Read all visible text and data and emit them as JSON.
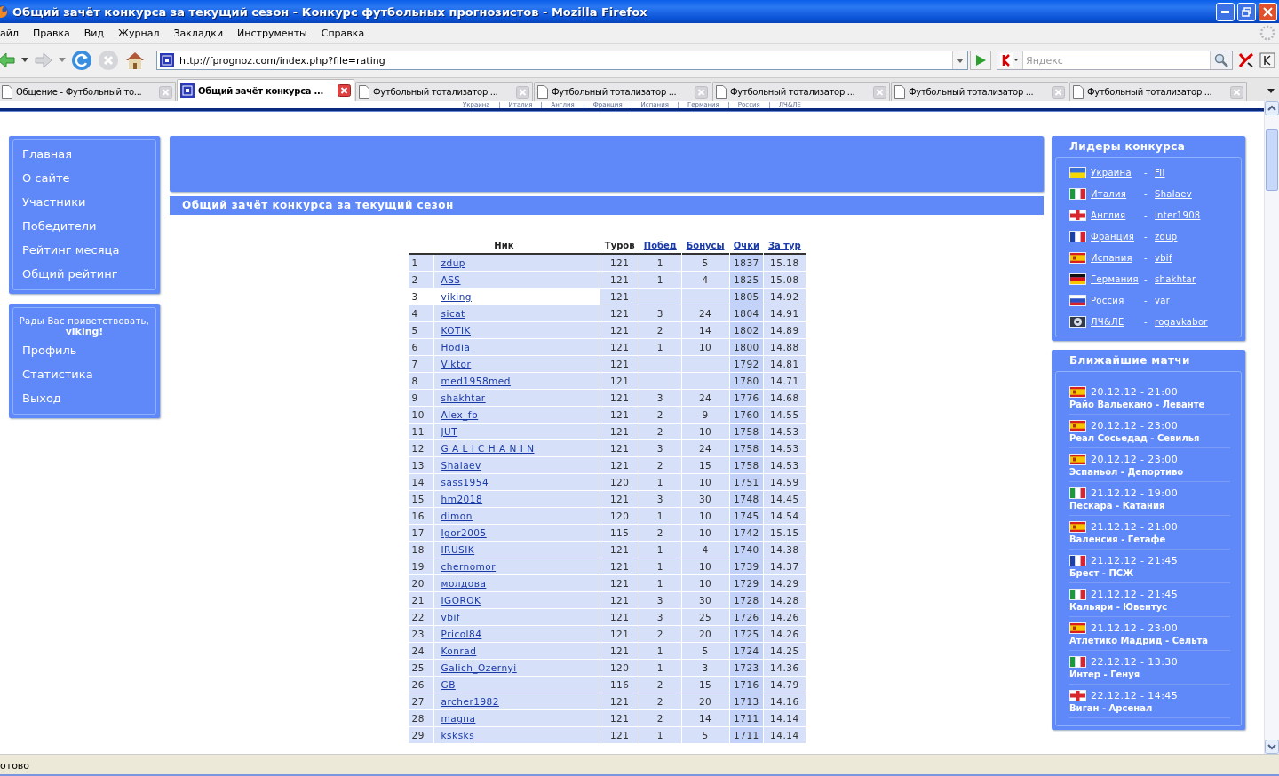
{
  "window": {
    "title": "Общий зачёт конкурса за текущий сезон - Конкурс футбольных прогнозистов - Mozilla Firefox"
  },
  "menu": [
    "айл",
    "Правка",
    "Вид",
    "Журнал",
    "Закладки",
    "Инструменты",
    "Справка"
  ],
  "toolbar": {
    "url": "http://fprognoz.com/index.php?file=rating",
    "search_placeholder": "Яндекс"
  },
  "tabs": [
    {
      "label": "Общение - Футбольный то...",
      "selected": false
    },
    {
      "label": "Общий зачёт конкурса ...",
      "selected": true
    },
    {
      "label": "Футбольный тотализатор ...",
      "selected": false
    },
    {
      "label": "Футбольный тотализатор ...",
      "selected": false
    },
    {
      "label": "Футбольный тотализатор ...",
      "selected": false
    },
    {
      "label": "Футбольный тотализатор ...",
      "selected": false
    },
    {
      "label": "Футбольный тотализатор ...",
      "selected": false
    }
  ],
  "site_nav": [
    "Украина",
    "Италия",
    "Англия",
    "Франция",
    "Испания",
    "Германия",
    "Россия",
    "ЛЧ&ЛЕ"
  ],
  "sidebar": {
    "menu": [
      "Главная",
      "О сайте",
      "Участники",
      "Победители",
      "Рейтинг месяца",
      "Общий рейтинг"
    ],
    "greeting": "Рады Вас приветствовать,",
    "user": "viking!",
    "user_menu": [
      "Профиль",
      "Статистика",
      "Выход"
    ]
  },
  "page_title": "Общий зачёт конкурса за текущий сезон",
  "table": {
    "columns": [
      {
        "label": "Ник",
        "sortable": false
      },
      {
        "label": "Туров",
        "sortable": false
      },
      {
        "label": "Побед",
        "sortable": true
      },
      {
        "label": "Бонусы",
        "sortable": true
      },
      {
        "label": "Очки",
        "sortable": true
      },
      {
        "label": "За тур",
        "sortable": true
      }
    ],
    "rows": [
      {
        "rank": "1",
        "nick": "zdup",
        "tours": "121",
        "wins": "1",
        "bonus": "5",
        "points": "1837",
        "per_tour": "15.18",
        "selected": false
      },
      {
        "rank": "2",
        "nick": "ASS",
        "tours": "121",
        "wins": "1",
        "bonus": "4",
        "points": "1825",
        "per_tour": "15.08",
        "selected": false
      },
      {
        "rank": "3",
        "nick": "viking",
        "tours": "121",
        "wins": "",
        "bonus": "",
        "points": "1805",
        "per_tour": "14.92",
        "selected": true
      },
      {
        "rank": "4",
        "nick": "sicat",
        "tours": "121",
        "wins": "3",
        "bonus": "24",
        "points": "1804",
        "per_tour": "14.91",
        "selected": false
      },
      {
        "rank": "5",
        "nick": "KOTIK",
        "tours": "121",
        "wins": "2",
        "bonus": "14",
        "points": "1802",
        "per_tour": "14.89",
        "selected": false
      },
      {
        "rank": "6",
        "nick": "Hodia",
        "tours": "121",
        "wins": "1",
        "bonus": "10",
        "points": "1800",
        "per_tour": "14.88",
        "selected": false
      },
      {
        "rank": "7",
        "nick": "Viktor",
        "tours": "121",
        "wins": "",
        "bonus": "",
        "points": "1792",
        "per_tour": "14.81",
        "selected": false
      },
      {
        "rank": "8",
        "nick": "med1958med",
        "tours": "121",
        "wins": "",
        "bonus": "",
        "points": "1780",
        "per_tour": "14.71",
        "selected": false
      },
      {
        "rank": "9",
        "nick": "shakhtar",
        "tours": "121",
        "wins": "3",
        "bonus": "24",
        "points": "1776",
        "per_tour": "14.68",
        "selected": false
      },
      {
        "rank": "10",
        "nick": "Alex_fb",
        "tours": "121",
        "wins": "2",
        "bonus": "9",
        "points": "1760",
        "per_tour": "14.55",
        "selected": false
      },
      {
        "rank": "11",
        "nick": "JUT",
        "tours": "121",
        "wins": "2",
        "bonus": "10",
        "points": "1758",
        "per_tour": "14.53",
        "selected": false
      },
      {
        "rank": "12",
        "nick": "G A L I C H A N I N",
        "tours": "121",
        "wins": "3",
        "bonus": "24",
        "points": "1758",
        "per_tour": "14.53",
        "selected": false
      },
      {
        "rank": "13",
        "nick": "Shalaev",
        "tours": "121",
        "wins": "2",
        "bonus": "15",
        "points": "1758",
        "per_tour": "14.53",
        "selected": false
      },
      {
        "rank": "14",
        "nick": "sass1954",
        "tours": "120",
        "wins": "1",
        "bonus": "10",
        "points": "1751",
        "per_tour": "14.59",
        "selected": false
      },
      {
        "rank": "15",
        "nick": "hm2018",
        "tours": "121",
        "wins": "3",
        "bonus": "30",
        "points": "1748",
        "per_tour": "14.45",
        "selected": false
      },
      {
        "rank": "16",
        "nick": "dimon",
        "tours": "120",
        "wins": "1",
        "bonus": "10",
        "points": "1745",
        "per_tour": "14.54",
        "selected": false
      },
      {
        "rank": "17",
        "nick": "Igor2005",
        "tours": "115",
        "wins": "2",
        "bonus": "10",
        "points": "1742",
        "per_tour": "15.15",
        "selected": false
      },
      {
        "rank": "18",
        "nick": "IRUSIK",
        "tours": "121",
        "wins": "1",
        "bonus": "4",
        "points": "1740",
        "per_tour": "14.38",
        "selected": false
      },
      {
        "rank": "19",
        "nick": "chernomor",
        "tours": "121",
        "wins": "1",
        "bonus": "10",
        "points": "1739",
        "per_tour": "14.37",
        "selected": false
      },
      {
        "rank": "20",
        "nick": "молдова",
        "tours": "121",
        "wins": "1",
        "bonus": "10",
        "points": "1729",
        "per_tour": "14.29",
        "selected": false
      },
      {
        "rank": "21",
        "nick": "IGOROK",
        "tours": "121",
        "wins": "3",
        "bonus": "30",
        "points": "1728",
        "per_tour": "14.28",
        "selected": false
      },
      {
        "rank": "22",
        "nick": "vbif",
        "tours": "121",
        "wins": "3",
        "bonus": "25",
        "points": "1726",
        "per_tour": "14.26",
        "selected": false
      },
      {
        "rank": "23",
        "nick": "Pricol84",
        "tours": "121",
        "wins": "2",
        "bonus": "20",
        "points": "1725",
        "per_tour": "14.26",
        "selected": false
      },
      {
        "rank": "24",
        "nick": "Konrad",
        "tours": "121",
        "wins": "1",
        "bonus": "5",
        "points": "1724",
        "per_tour": "14.25",
        "selected": false
      },
      {
        "rank": "25",
        "nick": "Galich_Ozernyi",
        "tours": "120",
        "wins": "1",
        "bonus": "3",
        "points": "1723",
        "per_tour": "14.36",
        "selected": false
      },
      {
        "rank": "26",
        "nick": "GB",
        "tours": "116",
        "wins": "2",
        "bonus": "15",
        "points": "1716",
        "per_tour": "14.79",
        "selected": false
      },
      {
        "rank": "27",
        "nick": "archer1982",
        "tours": "121",
        "wins": "2",
        "bonus": "20",
        "points": "1713",
        "per_tour": "14.16",
        "selected": false
      },
      {
        "rank": "28",
        "nick": "magna",
        "tours": "121",
        "wins": "2",
        "bonus": "14",
        "points": "1711",
        "per_tour": "14.14",
        "selected": false
      },
      {
        "rank": "29",
        "nick": "ksksks",
        "tours": "121",
        "wins": "1",
        "bonus": "5",
        "points": "1711",
        "per_tour": "14.14",
        "selected": false
      }
    ]
  },
  "leaders": {
    "title": "Лидеры конкурса",
    "items": [
      {
        "kind": "ua",
        "league": "Украина",
        "dash": "-",
        "user": "Fil"
      },
      {
        "kind": "it",
        "league": "Италия",
        "dash": "-",
        "user": "Shalaev"
      },
      {
        "kind": "en",
        "league": "Англия",
        "dash": "-",
        "user": "inter1908"
      },
      {
        "kind": "fr",
        "league": "Франция",
        "dash": "-",
        "user": "zdup"
      },
      {
        "kind": "es",
        "league": "Испания",
        "dash": "-",
        "user": "vbif"
      },
      {
        "kind": "de",
        "league": "Германия",
        "dash": "-",
        "user": "shakhtar"
      },
      {
        "kind": "ru",
        "league": "Россия",
        "dash": "-",
        "user": "var"
      },
      {
        "kind": "cl",
        "league": "ЛЧ&ЛЕ",
        "dash": "-",
        "user": "rogavkabor"
      }
    ]
  },
  "matches": {
    "title": "Ближайшие матчи",
    "items": [
      {
        "kind": "es",
        "time": "20.12.12 - 21:00",
        "teams": "Райо Вальекано - Леванте"
      },
      {
        "kind": "es",
        "time": "20.12.12 - 23:00",
        "teams": "Реал Сосьедад - Севилья"
      },
      {
        "kind": "es",
        "time": "20.12.12 - 23:00",
        "teams": "Эспаньол - Депортиво"
      },
      {
        "kind": "it",
        "time": "21.12.12 - 19:00",
        "teams": "Пескара - Катания"
      },
      {
        "kind": "es",
        "time": "21.12.12 - 21:00",
        "teams": "Валенсия - Гетафе"
      },
      {
        "kind": "fr",
        "time": "21.12.12 - 21:45",
        "teams": "Брест - ПСЖ"
      },
      {
        "kind": "it",
        "time": "21.12.12 - 21:45",
        "teams": "Кальяри - Ювентус"
      },
      {
        "kind": "es",
        "time": "21.12.12 - 23:00",
        "teams": "Атлетико Мадрид - Сельта"
      },
      {
        "kind": "it",
        "time": "22.12.12 - 13:30",
        "teams": "Интер - Генуя"
      },
      {
        "kind": "en",
        "time": "22.12.12 - 14:45",
        "teams": "Виган - Арсенал"
      }
    ]
  },
  "status_bar": "отово"
}
